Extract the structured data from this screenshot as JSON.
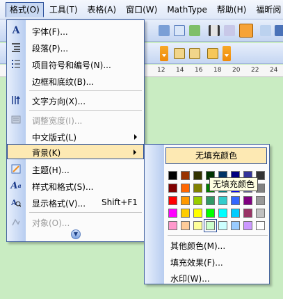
{
  "menubar": {
    "items": [
      "格式(O)",
      "工具(T)",
      "表格(A)",
      "窗口(W)",
      "MathType",
      "帮助(H)",
      "福昕阅"
    ]
  },
  "ruler": [
    "12",
    "14",
    "16",
    "18",
    "20",
    "22",
    "24"
  ],
  "format_menu": {
    "items": [
      {
        "label": "字体(F)...",
        "icon": "font-A-icon"
      },
      {
        "label": "段落(P)...",
        "icon": "paragraph-icon"
      },
      {
        "label": "项目符号和编号(N)...",
        "icon": "bullets-icon"
      },
      {
        "label": "边框和底纹(B)...",
        "icon": "borders-icon"
      },
      {
        "label": "文字方向(X)...",
        "icon": "text-direction-icon"
      },
      {
        "label": "调整宽度(I)...",
        "icon": "adjust-width-icon",
        "disabled": true
      },
      {
        "label": "中文版式(L)",
        "icon": "",
        "submenu": true
      },
      {
        "label": "背景(K)",
        "icon": "",
        "submenu": true,
        "highlighted": true
      },
      {
        "label": "主题(H)...",
        "icon": "theme-icon"
      },
      {
        "label": "样式和格式(S)...",
        "icon": "styles-icon"
      },
      {
        "label": "显示格式(V)...",
        "icon": "reveal-format-icon",
        "shortcut": "Shift+F1"
      },
      {
        "label": "对象(O)...",
        "icon": "object-icon",
        "disabled": true
      }
    ]
  },
  "background_submenu": {
    "no_fill": "无填充颜色",
    "tooltip": "无填充颜色",
    "more_colors": "其他颜色(M)...",
    "fill_effects": "填充效果(F)...",
    "watermark": "水印(W)...",
    "palette": [
      [
        "#000000",
        "#993300",
        "#333300",
        "#003300",
        "#003366",
        "#000080",
        "#333399",
        "#333333"
      ],
      [
        "#800000",
        "#ff6600",
        "#808000",
        "#008000",
        "#008080",
        "#0000ff",
        "#666699",
        "#808080"
      ],
      [
        "#ff0000",
        "#ff9900",
        "#99cc00",
        "#339966",
        "#33cccc",
        "#3366ff",
        "#800080",
        "#999999"
      ],
      [
        "#ff00ff",
        "#ffcc00",
        "#ffff00",
        "#00ff00",
        "#00ffff",
        "#00ccff",
        "#993366",
        "#c0c0c0"
      ],
      [
        "#ff99cc",
        "#ffcc99",
        "#ffff99",
        "#ccffcc",
        "#ccffff",
        "#99ccff",
        "#cc99ff",
        "#ffffff"
      ]
    ],
    "selected_color": "#ccffcc"
  }
}
